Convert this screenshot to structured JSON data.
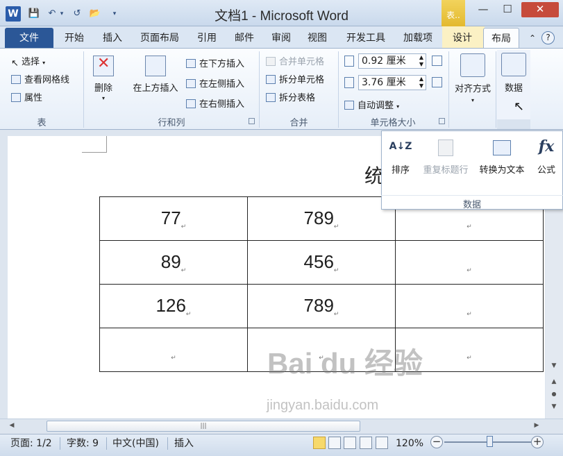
{
  "titlebar": {
    "title": "文档1 - Microsoft Word",
    "context_tab": "表..",
    "minimize": "—",
    "maximize": "☐",
    "close": "✕",
    "qat": {
      "save": "💾",
      "undo": "↶",
      "undo_drop": "▾",
      "redo": "↺",
      "open": "📂",
      "customize": "▾"
    },
    "logo": "W"
  },
  "tabs": {
    "file": "文件",
    "home": "开始",
    "insert": "插入",
    "page_layout": "页面布局",
    "references": "引用",
    "mailings": "邮件",
    "review": "审阅",
    "view": "视图",
    "developer": "开发工具",
    "addins": "加载项",
    "design": "设计",
    "layout": "布局",
    "minimize_ribbon": "⌃",
    "help": "?"
  },
  "ribbon": {
    "table": {
      "select": "选择",
      "gridlines": "查看网格线",
      "properties": "属性",
      "group": "表"
    },
    "rows_cols": {
      "delete": "删除",
      "insert_above": "在上方插入",
      "insert_below": "在下方插入",
      "insert_left": "在左侧插入",
      "insert_right": "在右侧插入",
      "group": "行和列"
    },
    "merge": {
      "merge_cells": "合并单元格",
      "split_cells": "拆分单元格",
      "split_table": "拆分表格",
      "group": "合并"
    },
    "cell_size": {
      "height": "0.92 厘米",
      "width": "3.76 厘米",
      "autofit": "自动调整",
      "group": "单元格大小"
    },
    "alignment": {
      "label": "对齐方式"
    },
    "data": {
      "label": "数据"
    }
  },
  "data_panel": {
    "sort": "排序",
    "repeat_header": "重复标题行",
    "convert_to_text": "转换为文本",
    "formula": "公式",
    "group": "数据",
    "icons": {
      "sort": "A↓Z",
      "formula": "fx"
    }
  },
  "document": {
    "title_partial": "统",
    "table": [
      [
        "77",
        "789",
        ""
      ],
      [
        "89",
        "456",
        ""
      ],
      [
        "126",
        "789",
        ""
      ],
      [
        "",
        "",
        ""
      ]
    ],
    "para_mark": "↵"
  },
  "statusbar": {
    "page": "页面: 1/2",
    "words": "字数: 9",
    "language": "中文(中国)",
    "mode": "插入",
    "zoom": "120%",
    "zoom_level": 0.5,
    "zoom_out": "−",
    "zoom_in": "+"
  },
  "watermark": {
    "line1": "Bai du 经验",
    "line2": "jingyan.baidu.com"
  },
  "colors": {
    "file_tab": "#2b5797",
    "close_button": "#c64b3b",
    "context_tab": "#e3b92e"
  }
}
